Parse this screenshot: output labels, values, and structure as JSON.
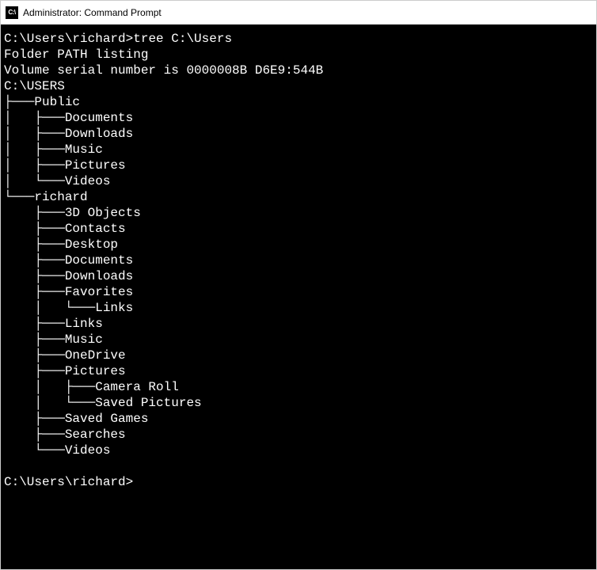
{
  "titlebar": {
    "icon_label": "C:\\",
    "title": "Administrator: Command Prompt"
  },
  "terminal": {
    "prompt1_path": "C:\\Users\\richard>",
    "prompt1_cmd": "tree C:\\Users",
    "header_line1": "Folder PATH listing",
    "header_line2": "Volume serial number is 0000008B D6E9:544B",
    "root": "C:\\USERS",
    "tree_lines": [
      "├───Public",
      "│   ├───Documents",
      "│   ├───Downloads",
      "│   ├───Music",
      "│   ├───Pictures",
      "│   └───Videos",
      "└───richard",
      "    ├───3D Objects",
      "    ├───Contacts",
      "    ├───Desktop",
      "    ├───Documents",
      "    ├───Downloads",
      "    ├───Favorites",
      "    │   └───Links",
      "    ├───Links",
      "    ├───Music",
      "    ├───OneDrive",
      "    ├───Pictures",
      "    │   ├───Camera Roll",
      "    │   └───Saved Pictures",
      "    ├───Saved Games",
      "    ├───Searches",
      "    └───Videos"
    ],
    "prompt2_path": "C:\\Users\\richard>"
  }
}
